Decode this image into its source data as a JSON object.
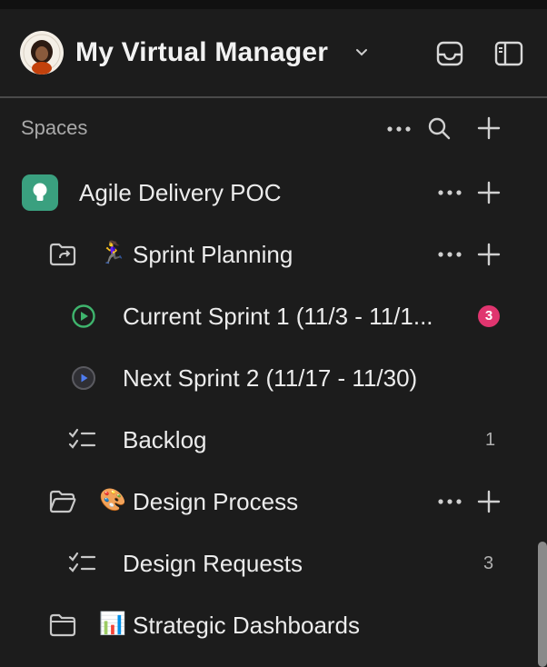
{
  "header": {
    "workspace_name": "My Virtual Manager"
  },
  "spaces": {
    "heading": "Spaces",
    "space_name": "Agile Delivery POC",
    "items": [
      {
        "emoji": "🏃‍♀️",
        "label": "Sprint Planning"
      },
      {
        "label": "Current Sprint 1 (11/3 - 11/1...",
        "badge": "3",
        "badge_color": "#e0356f"
      },
      {
        "label": "Next Sprint 2 (11/17 - 11/30)"
      },
      {
        "label": "Backlog",
        "count": "1"
      },
      {
        "emoji": "🎨",
        "label": "Design Process"
      },
      {
        "label": "Design Requests",
        "count": "3"
      },
      {
        "emoji": "📊",
        "label": "Strategic Dashboards"
      }
    ]
  },
  "colors": {
    "background": "#1c1c1c",
    "space_icon": "#3aa07f",
    "current_sprint_icon": "#3fb46d",
    "next_sprint_icon": "#4e7cf0"
  }
}
